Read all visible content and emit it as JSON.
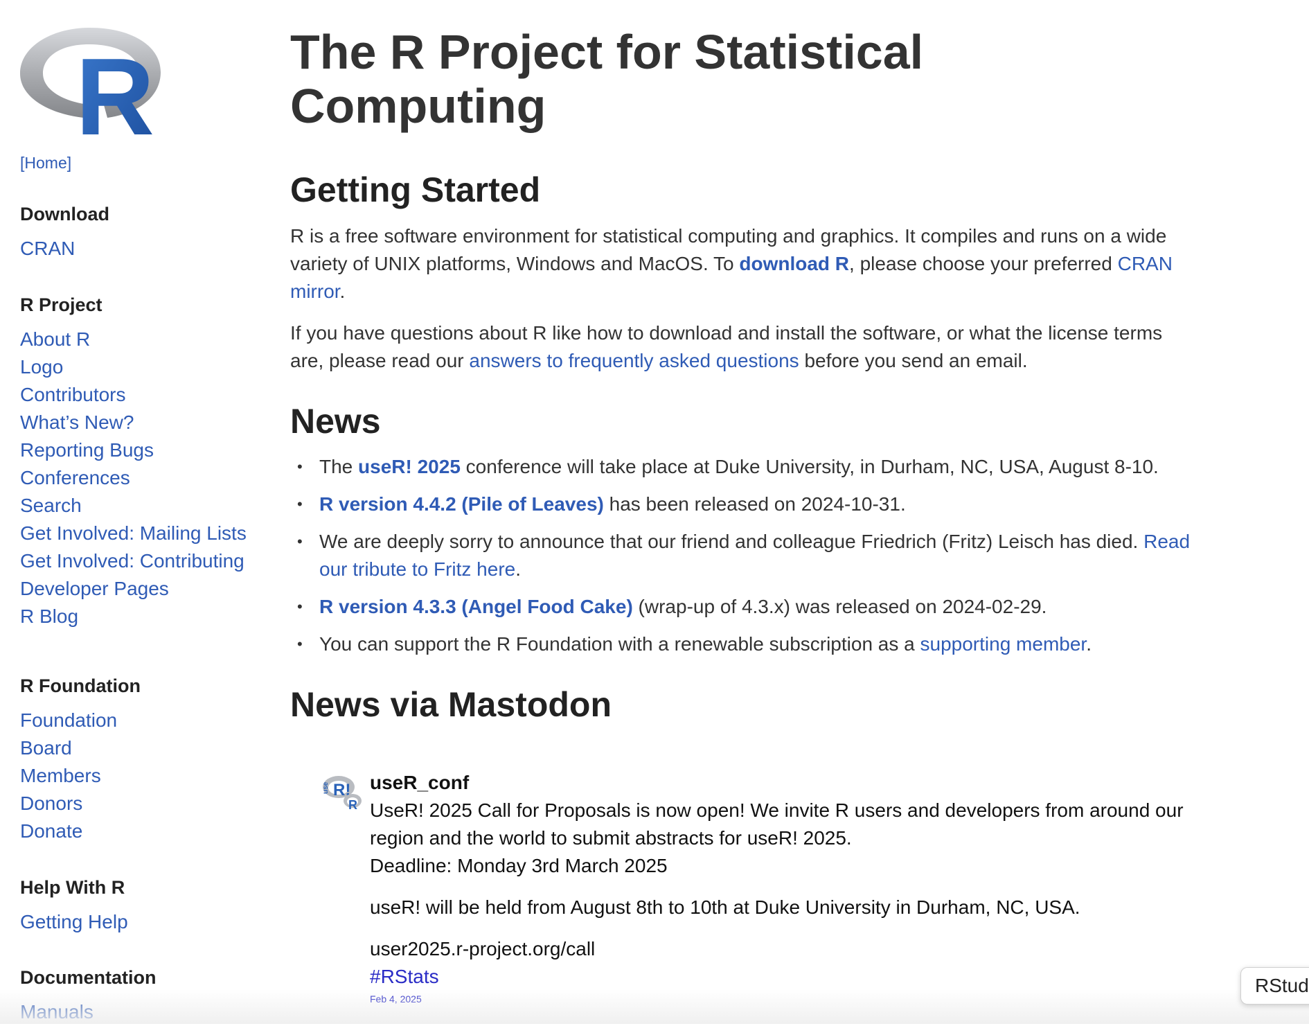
{
  "sidebar": {
    "home": "[Home]",
    "sections": [
      {
        "heading": "Download",
        "links": [
          "CRAN"
        ]
      },
      {
        "heading": "R Project",
        "links": [
          "About R",
          "Logo",
          "Contributors",
          "What’s New?",
          "Reporting Bugs",
          "Conferences",
          "Search",
          "Get Involved: Mailing Lists",
          "Get Involved: Contributing",
          "Developer Pages",
          "R Blog"
        ]
      },
      {
        "heading": "R Foundation",
        "links": [
          "Foundation",
          "Board",
          "Members",
          "Donors",
          "Donate"
        ]
      },
      {
        "heading": "Help With R",
        "links": [
          "Getting Help"
        ]
      },
      {
        "heading": "Documentation",
        "links": [
          "Manuals"
        ]
      }
    ]
  },
  "main": {
    "title": "The R Project for Statistical Computing",
    "getting_started": {
      "heading": "Getting Started",
      "p1_a": "R is a free software environment for statistical computing and graphics. It compiles and runs on a wide variety of UNIX platforms, Windows and MacOS. To ",
      "p1_link1": "download R",
      "p1_b": ", please choose your preferred ",
      "p1_link2": "CRAN mirror",
      "p1_c": ".",
      "p2_a": "If you have questions about R like how to download and install the software, or what the license terms are, please read our ",
      "p2_link": "answers to frequently asked questions",
      "p2_b": " before you send an email."
    },
    "news": {
      "heading": "News",
      "items": [
        {
          "a": "The ",
          "link": "useR! 2025",
          "b": " conference will take place at Duke University, in Durham, NC, USA, August 8-10."
        },
        {
          "a": "",
          "link": "R version 4.4.2 (Pile of Leaves)",
          "b": " has been released on 2024-10-31."
        },
        {
          "a": "We are deeply sorry to announce that our friend and colleague Friedrich (Fritz) Leisch has died. ",
          "link": "Read our tribute to Fritz here",
          "b": "."
        },
        {
          "a": "",
          "link": "R version 4.3.3 (Angel Food Cake)",
          "b": " (wrap-up of 4.3.x) was released on 2024-02-29."
        },
        {
          "a": "You can support the R Foundation with a renewable subscription as a ",
          "link": "supporting member",
          "b": "."
        }
      ]
    },
    "mastodon": {
      "heading": "News via Mastodon",
      "post": {
        "user": "useR_conf",
        "line1": "UseR! 2025 Call for Proposals is now open! We invite R users and developers from around our region and the world to submit abstracts for useR! 2025.",
        "line2": "Deadline: Monday 3rd March 2025",
        "line3": "useR! will be held from August 8th to 10th at Duke University in Durham, NC, USA.",
        "url": "user2025.r-project.org/call",
        "tag": "#RStats",
        "date": "Feb 4, 2025",
        "avatar_text_1": "use",
        "avatar_text_2": "R!",
        "avatar_text_3": "R"
      }
    }
  },
  "tooltip": "RStudio",
  "logo_letter": "R",
  "colors": {
    "link": "#2f5bb5",
    "logo_blue": "#2a62b8",
    "text": "#333333",
    "heading": "#222222",
    "tag": "#2a2cc6"
  }
}
